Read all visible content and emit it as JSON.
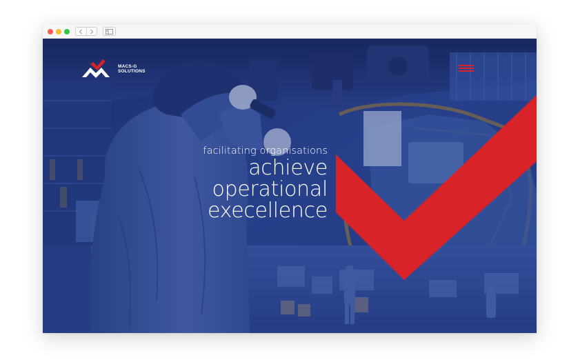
{
  "browser": {
    "traffic_lights": [
      "close",
      "minimize",
      "zoom"
    ],
    "nav": {
      "back_icon": "chevron-left-icon",
      "forward_icon": "chevron-right-icon"
    },
    "sidebar_icon": "sidebar-icon"
  },
  "site": {
    "logo": {
      "line1": "MACS-G",
      "line2": "SOLUTIONS"
    },
    "menu_icon": "hamburger-menu-icon",
    "hero": {
      "subtitle": "facilitating organisations",
      "headline_lines": [
        "achieve",
        "operational",
        "execellence"
      ]
    }
  },
  "colors": {
    "brand_red": "#d82328",
    "overlay_navy": "#1e2f6e",
    "text": "#ffffff"
  }
}
